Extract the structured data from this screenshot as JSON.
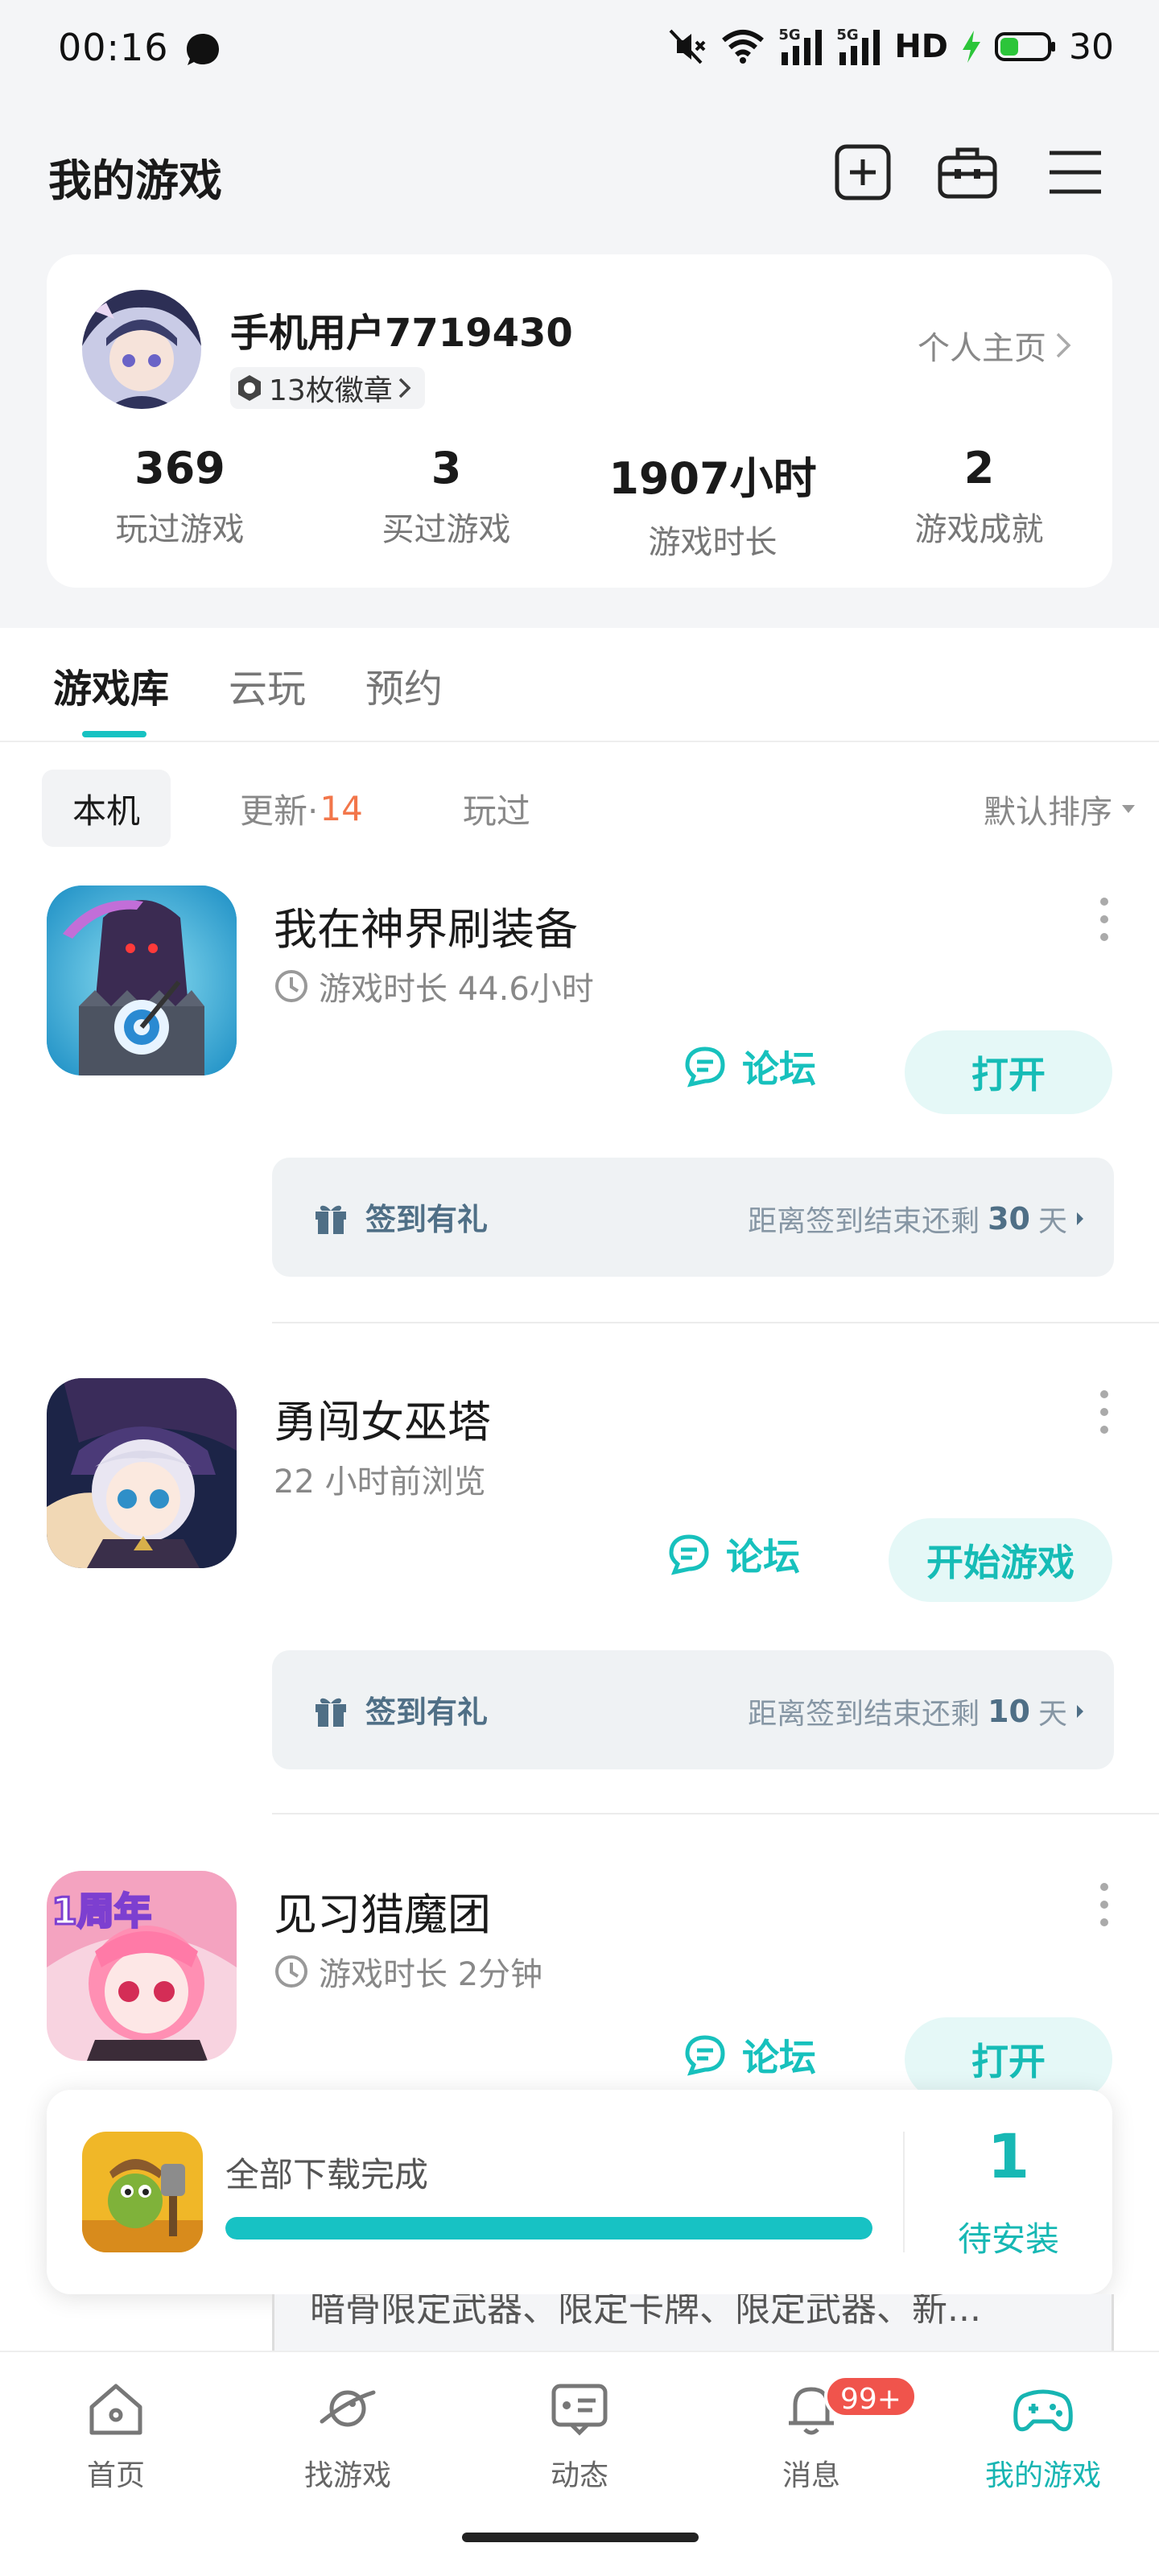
{
  "status_bar": {
    "time": "00:16",
    "network_5g_1": "5G",
    "network_5g_2": "5G",
    "hd_label": "HD",
    "battery": "30"
  },
  "header": {
    "title": "我的游戏"
  },
  "profile": {
    "username": "手机用户7719430",
    "badges": "13枚徽章",
    "home_link": "个人主页",
    "stats": [
      {
        "value": "369",
        "label": "玩过游戏"
      },
      {
        "value": "3",
        "label": "买过游戏"
      },
      {
        "value": "1907小时",
        "label": "游戏时长"
      },
      {
        "value": "2",
        "label": "游戏成就"
      }
    ]
  },
  "tabs": [
    "游戏库",
    "云玩",
    "预约"
  ],
  "filters": {
    "local": "本机",
    "update": "更新·",
    "update_count": "14",
    "played": "玩过",
    "sort": "默认排序"
  },
  "games": [
    {
      "name": "我在神界刷装备",
      "sub": "游戏时长 44.6小时",
      "forum": "论坛",
      "action": "打开",
      "sign_label": "签到有礼",
      "sign_remaining_prefix": "距离签到结束还剩",
      "sign_days": "30",
      "sign_unit": "天"
    },
    {
      "name": "勇闯女巫塔",
      "sub": "22 小时前浏览",
      "forum": "论坛",
      "action": "开始游戏",
      "sign_label": "签到有礼",
      "sign_remaining_prefix": "距离签到结束还剩",
      "sign_days": "10",
      "sign_unit": "天"
    },
    {
      "name": "见习猎魔团",
      "sub": "游戏时长 2分钟",
      "forum": "论坛",
      "action": "打开",
      "icon_badge": "1周年"
    }
  ],
  "download": {
    "status": "全部下载完成",
    "progress": 1.0,
    "pending_count": "1",
    "pending_label": "待安装"
  },
  "peek_text": "暗骨限定武器、限定卡牌、限定武器、新...",
  "bottom_nav": [
    {
      "label": "首页",
      "icon": "home-icon"
    },
    {
      "label": "找游戏",
      "icon": "planet-icon"
    },
    {
      "label": "动态",
      "icon": "message-card-icon"
    },
    {
      "label": "消息",
      "icon": "bell-icon",
      "badge": "99+"
    },
    {
      "label": "我的游戏",
      "icon": "gamepad-icon"
    }
  ],
  "colors": {
    "accent": "#17c2c4",
    "badge_red": "#f0544c",
    "update_orange": "#f2764a"
  }
}
